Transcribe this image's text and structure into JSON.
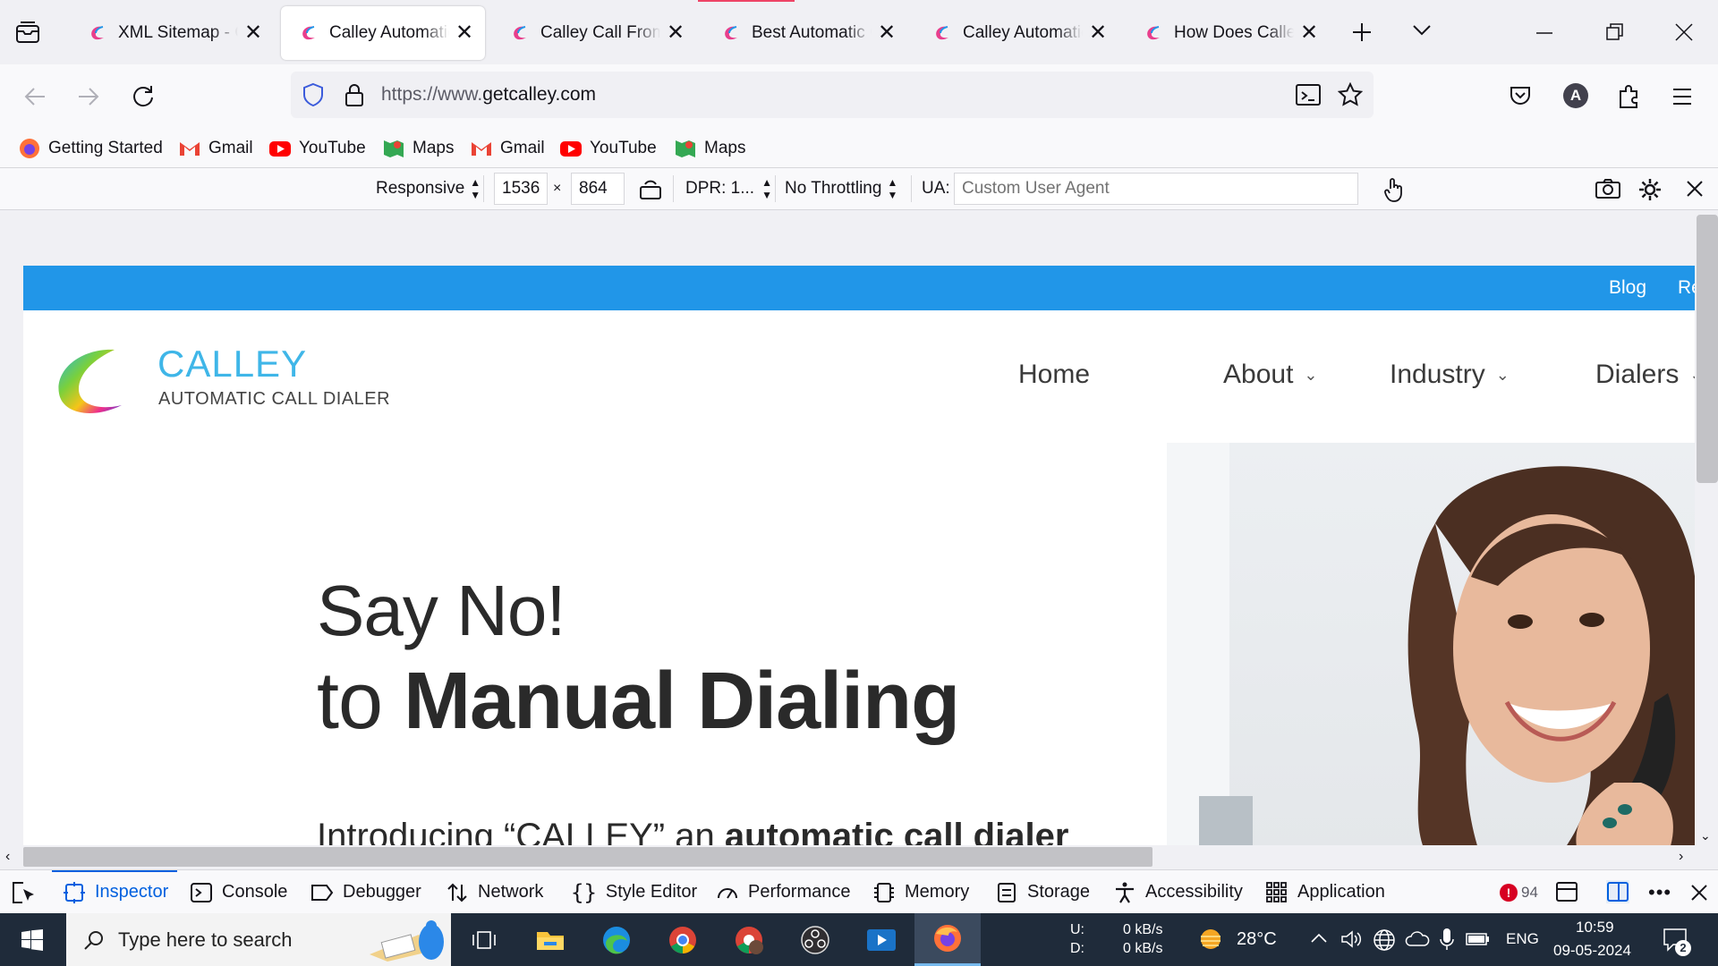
{
  "tabs": [
    {
      "title": "XML Sitemap - Calley",
      "active": false
    },
    {
      "title": "Calley Automatic Call Dialer",
      "active": true
    },
    {
      "title": "Calley Call From Excel",
      "active": false
    },
    {
      "title": "Best Automatic Call Dialer",
      "active": false
    },
    {
      "title": "Calley Automatic Call Dialer",
      "active": false
    },
    {
      "title": "How Does Calley Work",
      "active": false
    }
  ],
  "nav": {
    "url_prefix": "https://www.",
    "url_domain": "getcalley.com",
    "profile_initial": "A"
  },
  "bookmarks": [
    {
      "label": "Getting Started",
      "icon": "firefox-icon"
    },
    {
      "label": "Gmail",
      "icon": "gmail-icon"
    },
    {
      "label": "YouTube",
      "icon": "youtube-icon"
    },
    {
      "label": "Maps",
      "icon": "maps-icon"
    },
    {
      "label": "Gmail",
      "icon": "gmail-icon"
    },
    {
      "label": "YouTube",
      "icon": "youtube-icon"
    },
    {
      "label": "Maps",
      "icon": "maps-icon"
    }
  ],
  "rdm": {
    "device": "Responsive",
    "width": "1536",
    "times": "×",
    "height": "864",
    "dpr": "DPR: 1...",
    "throttling": "No Throttling",
    "ua_label": "UA:",
    "ua_placeholder": "Custom User Agent"
  },
  "site": {
    "top_links": [
      "Blog",
      "Re"
    ],
    "brand": "CALLEY",
    "tagline": "AUTOMATIC CALL DIALER",
    "menu": [
      {
        "label": "Home",
        "dropdown": false
      },
      {
        "label": "About",
        "dropdown": true
      },
      {
        "label": "Industry",
        "dropdown": true
      },
      {
        "label": "Dialers",
        "dropdown": true
      }
    ],
    "hero_line1": "Say No!",
    "hero_line2_prefix": "to ",
    "hero_line2_bold": "Manual Dialing",
    "intro_prefix": "Introducing “CALLEY” an ",
    "intro_bold": "automatic call dialer",
    "accent_color": "#2196e8"
  },
  "devtools": {
    "tabs": [
      {
        "label": "Inspector",
        "icon": "inspector-icon",
        "selected": true
      },
      {
        "label": "Console",
        "icon": "console-icon",
        "selected": false
      },
      {
        "label": "Debugger",
        "icon": "debugger-icon",
        "selected": false
      },
      {
        "label": "Network",
        "icon": "network-icon",
        "selected": false
      },
      {
        "label": "Style Editor",
        "icon": "style-editor-icon",
        "selected": false
      },
      {
        "label": "Performance",
        "icon": "performance-icon",
        "selected": false
      },
      {
        "label": "Memory",
        "icon": "memory-icon",
        "selected": false
      },
      {
        "label": "Storage",
        "icon": "storage-icon",
        "selected": false
      },
      {
        "label": "Accessibility",
        "icon": "accessibility-icon",
        "selected": false
      },
      {
        "label": "Application",
        "icon": "application-icon",
        "selected": false
      }
    ],
    "error_count": "94"
  },
  "taskbar": {
    "search_placeholder": "Type here to search",
    "net_up_label": "U:",
    "net_down_label": "D:",
    "net_up": "0 kB/s",
    "net_down": "0 kB/s",
    "temperature": "28°C",
    "language": "ENG",
    "time": "10:59",
    "date": "09-05-2024",
    "notification_count": "2"
  }
}
